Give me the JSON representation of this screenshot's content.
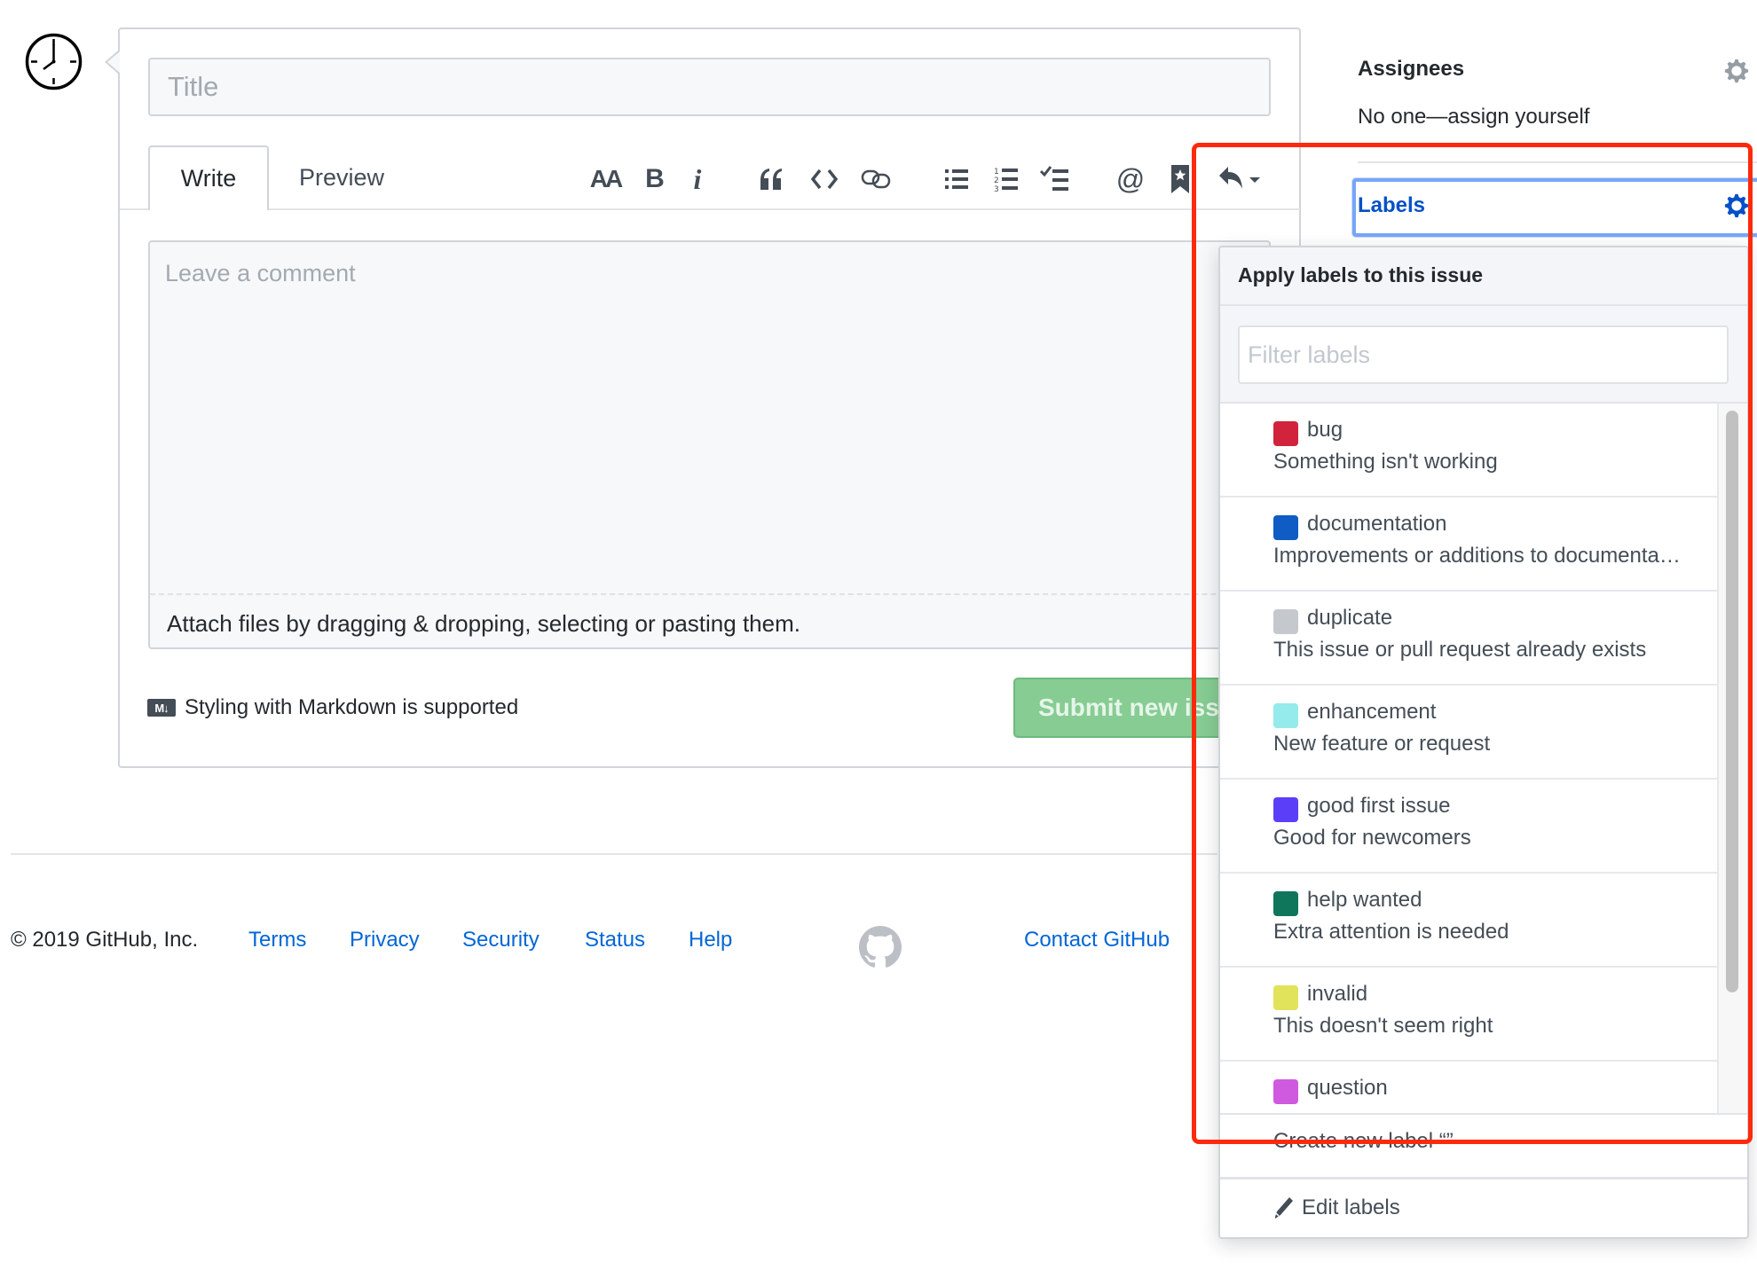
{
  "issue_form": {
    "title_placeholder": "Title",
    "tabs": [
      {
        "label": "Write",
        "active": true
      },
      {
        "label": "Preview",
        "active": false
      }
    ],
    "toolbar": {
      "heading_label": "AA",
      "bold_label": "B",
      "italic_label": "i",
      "icons": [
        "text-size-icon",
        "bold-icon",
        "italic-icon",
        "quote-icon",
        "code-icon",
        "link-icon",
        "unordered-list-icon",
        "ordered-list-icon",
        "task-list-icon",
        "mention-icon",
        "saved-reply-bookmark-icon",
        "reply-icon"
      ],
      "mention_label": "@"
    },
    "comment_placeholder": "Leave a comment",
    "attach_text": "Attach files by dragging & dropping, selecting or pasting them.",
    "markdown_icon_label": "M↓",
    "markdown_note": "Styling with Markdown is supported",
    "submit_label": "Submit new issue"
  },
  "sidebar": {
    "assignees_heading": "Assignees",
    "assignees_value": "No one—assign yourself",
    "labels_heading": "Labels",
    "label_accent": "#0450c8"
  },
  "labels_dropdown": {
    "header": "Apply labels to this issue",
    "filter_placeholder": "Filter labels",
    "filter_value": "",
    "items": [
      {
        "name": "bug",
        "description": "Something isn't working",
        "color": "#d1243c"
      },
      {
        "name": "documentation",
        "description": "Improvements or additions to documenta…",
        "color": "#0e5cc4"
      },
      {
        "name": "duplicate",
        "description": "This issue or pull request already exists",
        "color": "#c5c8cc"
      },
      {
        "name": "enhancement",
        "description": "New feature or request",
        "color": "#95ebeb"
      },
      {
        "name": "good first issue",
        "description": "Good for newcomers",
        "color": "#5b3ff8"
      },
      {
        "name": "help wanted",
        "description": "Extra attention is needed",
        "color": "#10765b"
      },
      {
        "name": "invalid",
        "description": "This doesn't seem right",
        "color": "#e1e35a"
      },
      {
        "name": "question",
        "description": "",
        "color": "#d05adf"
      }
    ],
    "create_label": "Create new label “”",
    "edit_label": "Edit labels"
  },
  "footer": {
    "copyright": "© 2019 GitHub, Inc.",
    "links": [
      "Terms",
      "Privacy",
      "Security",
      "Status",
      "Help"
    ],
    "contact": "Contact GitHub"
  },
  "colors": {
    "highlight": "#ff2a0c",
    "link": "#0366d6",
    "submit_bg": "#86cc93"
  }
}
